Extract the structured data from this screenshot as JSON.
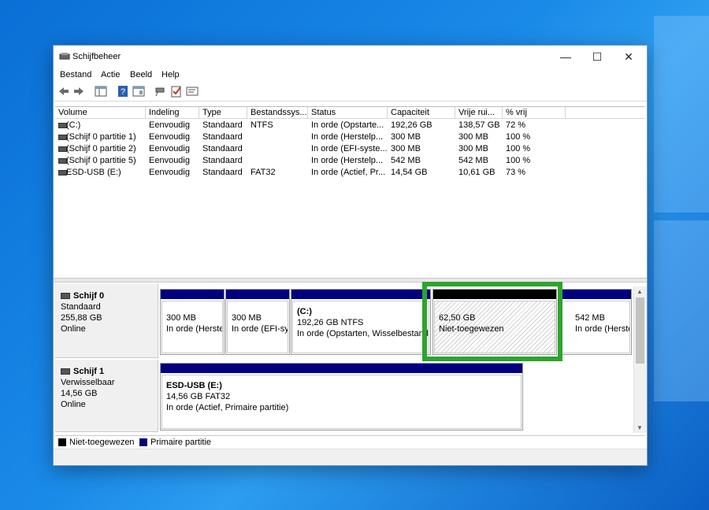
{
  "window": {
    "title": "Schijfbeheer",
    "minimize": "—",
    "maximize": "☐",
    "close": "✕"
  },
  "menu": [
    "Bestand",
    "Actie",
    "Beeld",
    "Help"
  ],
  "toolbar_icons": [
    "back-arrow-icon",
    "forward-arrow-icon",
    "console-tree-icon",
    "help-icon",
    "properties-icon",
    "connect-icon",
    "checklist-icon",
    "rescan-icon"
  ],
  "columns": [
    "Volume",
    "Indeling",
    "Type",
    "Bestandssys...",
    "Status",
    "Capaciteit",
    "Vrije rui...",
    "% vrij"
  ],
  "volumes": [
    {
      "volume": "(C:)",
      "layout": "Eenvoudig",
      "type": "Standaard",
      "fs": "NTFS",
      "status": "In orde (Opstarte...",
      "capacity": "192,26 GB",
      "free": "138,57 GB",
      "pct": "72 %"
    },
    {
      "volume": "(Schijf 0 partitie 1)",
      "layout": "Eenvoudig",
      "type": "Standaard",
      "fs": "",
      "status": "In orde (Herstelp...",
      "capacity": "300 MB",
      "free": "300 MB",
      "pct": "100 %"
    },
    {
      "volume": "(Schijf 0 partitie 2)",
      "layout": "Eenvoudig",
      "type": "Standaard",
      "fs": "",
      "status": "In orde (EFI-syste...",
      "capacity": "300 MB",
      "free": "300 MB",
      "pct": "100 %"
    },
    {
      "volume": "(Schijf 0 partitie 5)",
      "layout": "Eenvoudig",
      "type": "Standaard",
      "fs": "",
      "status": "In orde (Herstelp...",
      "capacity": "542 MB",
      "free": "542 MB",
      "pct": "100 %"
    },
    {
      "volume": "ESD-USB (E:)",
      "layout": "Eenvoudig",
      "type": "Standaard",
      "fs": "FAT32",
      "status": "In orde (Actief, Pr...",
      "capacity": "14,54 GB",
      "free": "10,61 GB",
      "pct": "73 %"
    }
  ],
  "disks": [
    {
      "name": "Schijf 0",
      "kind": "Standaard",
      "size": "255,88 GB",
      "state": "Online",
      "partitions": [
        {
          "title": "",
          "line1": "300 MB",
          "line2": "In orde (Herste"
        },
        {
          "title": "",
          "line1": "300 MB",
          "line2": "In orde (EFI-syste"
        },
        {
          "title": "(C:)",
          "line1": "192,26 GB NTFS",
          "line2": "In orde (Opstarten, Wisselbestand"
        },
        {
          "title": "",
          "line1": "62,50 GB",
          "line2": "Niet-toegewezen"
        },
        {
          "title": "",
          "line1": "542 MB",
          "line2": "In orde (Herstelp"
        }
      ]
    },
    {
      "name": "Schijf 1",
      "kind": "Verwisselbaar",
      "size": "14,56 GB",
      "state": "Online",
      "partitions": [
        {
          "title": "ESD-USB  (E:)",
          "line1": "14,56 GB FAT32",
          "line2": "In orde (Actief, Primaire partitie)"
        }
      ]
    }
  ],
  "legend": [
    {
      "label": "Niet-toegewezen",
      "color": "#000000"
    },
    {
      "label": "Primaire partitie",
      "color": "#000080"
    }
  ],
  "colors": {
    "primary_partition": "#000080",
    "unallocated": "#000000",
    "highlight": "#2ea32e"
  }
}
